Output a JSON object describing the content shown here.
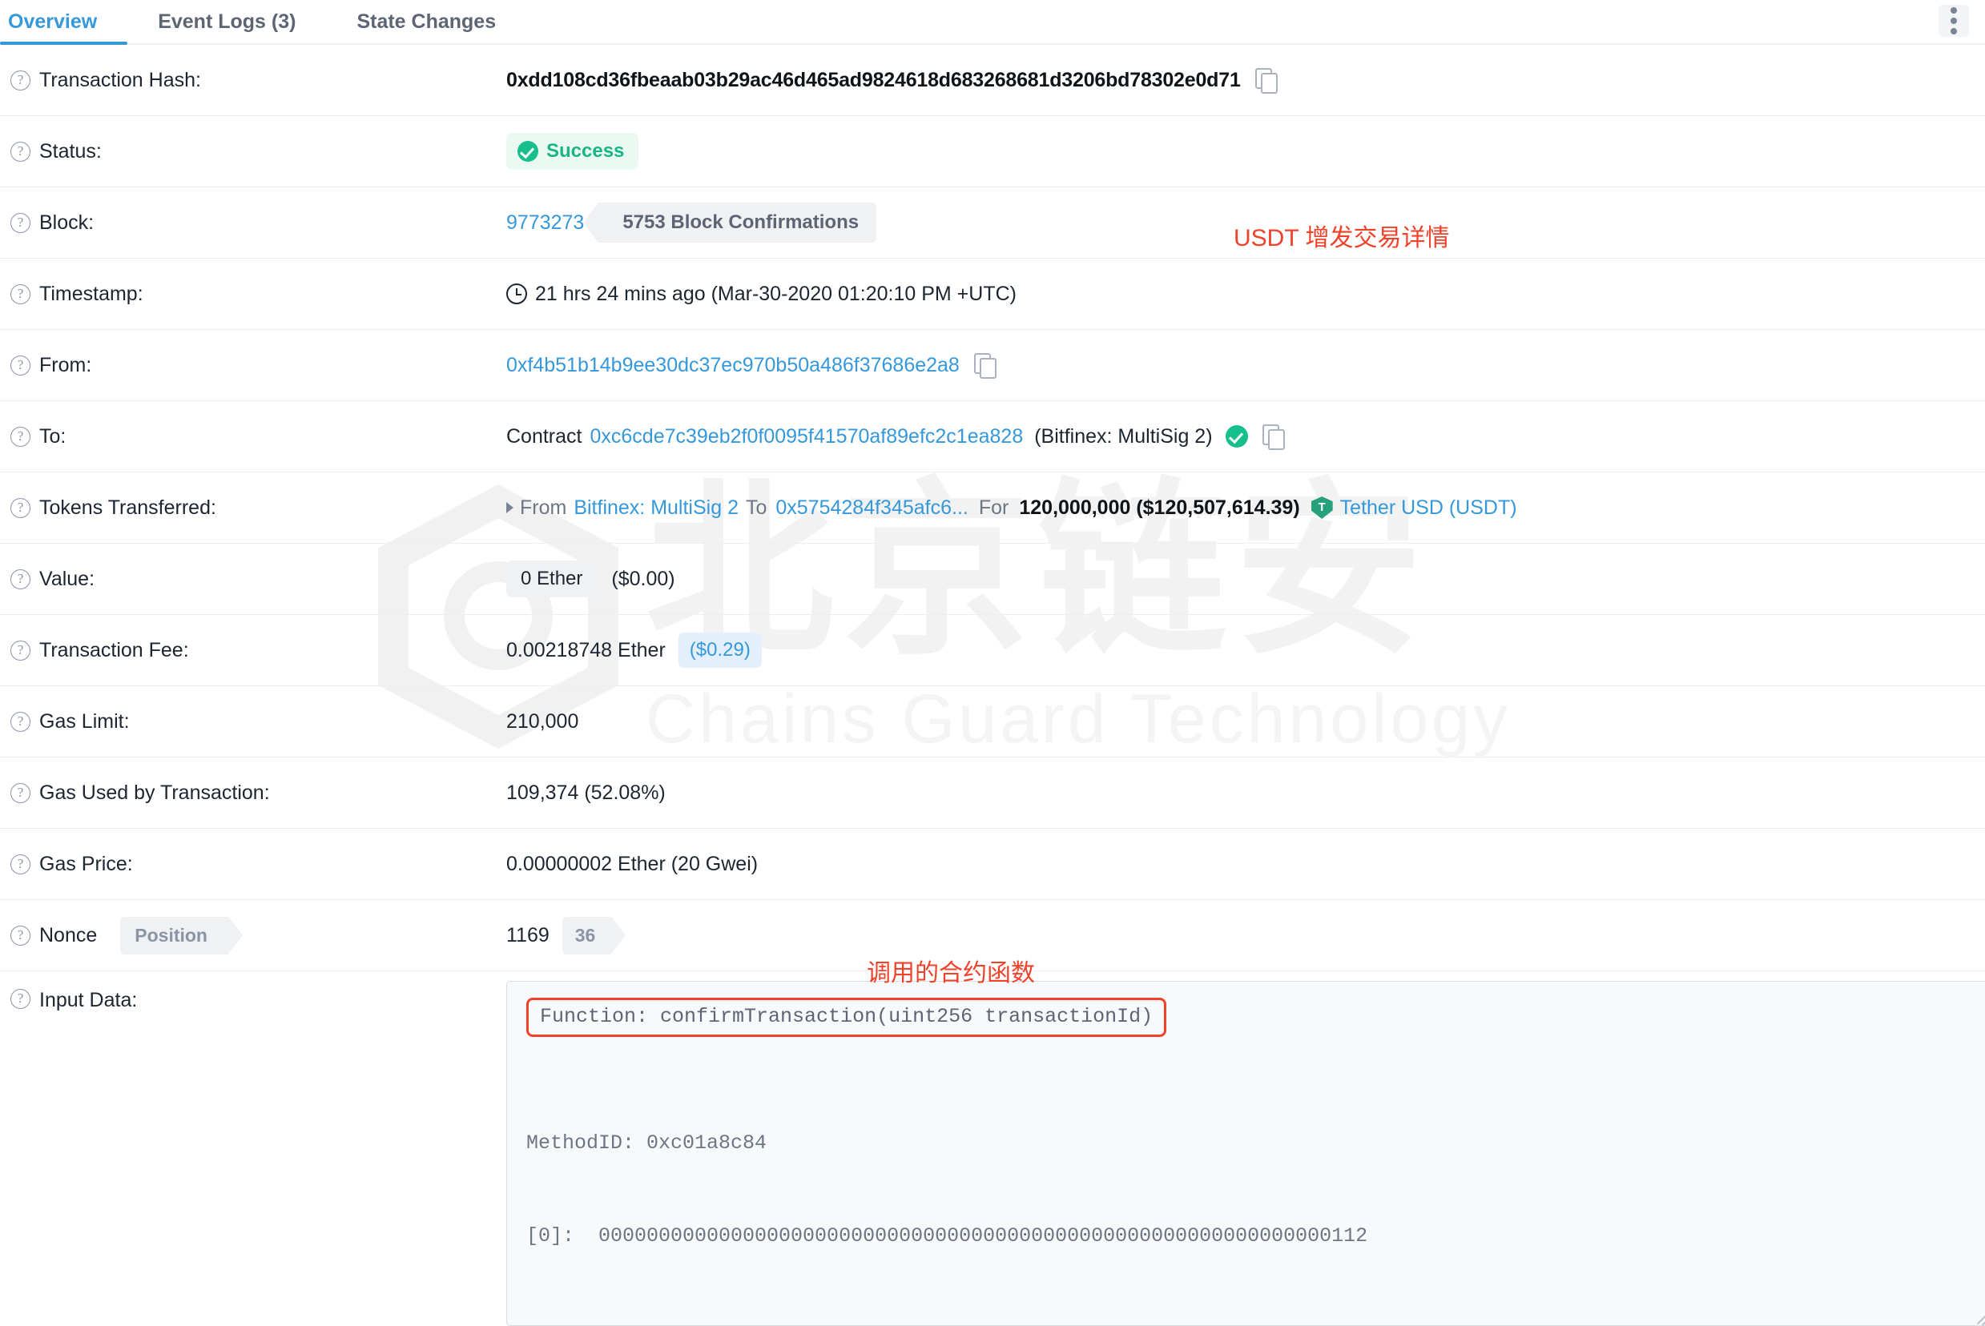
{
  "tabs": [
    {
      "label": "Overview",
      "active": true
    },
    {
      "label": "Event Logs (3)",
      "active": false
    },
    {
      "label": "State Changes",
      "active": false
    }
  ],
  "menu_icon": "kebab-menu-icon",
  "annotations": {
    "usdt": "USDT 增发交易详情",
    "function": "调用的合约函数",
    "color": "#f0422a"
  },
  "watermark": {
    "cn": "北京链安",
    "en": "Chains Guard Technology"
  },
  "rows": {
    "tx_hash": {
      "label": "Transaction Hash:",
      "value": "0xdd108cd36fbeaab03b29ac46d465ad9824618d683268681d3206bd78302e0d71",
      "copy_icon": "copy-icon"
    },
    "status": {
      "label": "Status:",
      "value": "Success",
      "icon": "check-circle-icon",
      "badge_bg": "#eafaf3",
      "badge_color": "#19b585"
    },
    "block": {
      "label": "Block:",
      "number": "9773273",
      "confirmations": "5753 Block Confirmations"
    },
    "timestamp": {
      "label": "Timestamp:",
      "icon": "clock-icon",
      "value": "21 hrs 24 mins ago (Mar-30-2020 01:20:10 PM +UTC)"
    },
    "from": {
      "label": "From:",
      "address": "0xf4b51b14b9ee30dc37ec970b50a486f37686e2a8",
      "copy_icon": "copy-icon"
    },
    "to": {
      "label": "To:",
      "prefix": "Contract",
      "address": "0xc6cde7c39eb2f0f0095f41570af89efc2c1ea828",
      "alias": "(Bitfinex: MultiSig 2)",
      "verified_icon": "verified-check-icon",
      "copy_icon": "copy-icon"
    },
    "tokens_transferred": {
      "label": "Tokens Transferred:",
      "expand_icon": "caret-right-icon",
      "from_word": "From",
      "from_name": "Bitfinex: MultiSig 2",
      "to_word": "To",
      "to_address": "0x5754284f345afc6...",
      "for_word": "For",
      "amount": "120,000,000 ($120,507,614.39)",
      "token_icon": "tether-token-icon",
      "token_name": "Tether USD (USDT)"
    },
    "value": {
      "label": "Value:",
      "ether": "0 Ether",
      "usd": "($0.00)"
    },
    "tx_fee": {
      "label": "Transaction Fee:",
      "ether": "0.00218748 Ether",
      "usd": "($0.29)"
    },
    "gas_limit": {
      "label": "Gas Limit:",
      "value": "210,000"
    },
    "gas_used": {
      "label": "Gas Used by Transaction:",
      "value": "109,374 (52.08%)"
    },
    "gas_price": {
      "label": "Gas Price:",
      "value": "0.00000002 Ether (20 Gwei)"
    },
    "nonce": {
      "label": "Nonce",
      "position_label": "Position",
      "nonce_value": "1169",
      "position_value": "36"
    },
    "input_data": {
      "label": "Input Data:",
      "function_line": "Function: confirmTransaction(uint256 transactionId)",
      "method_id_line": "MethodID: 0xc01a8c84",
      "arg_line": "[0]:  0000000000000000000000000000000000000000000000000000000000000112"
    }
  }
}
